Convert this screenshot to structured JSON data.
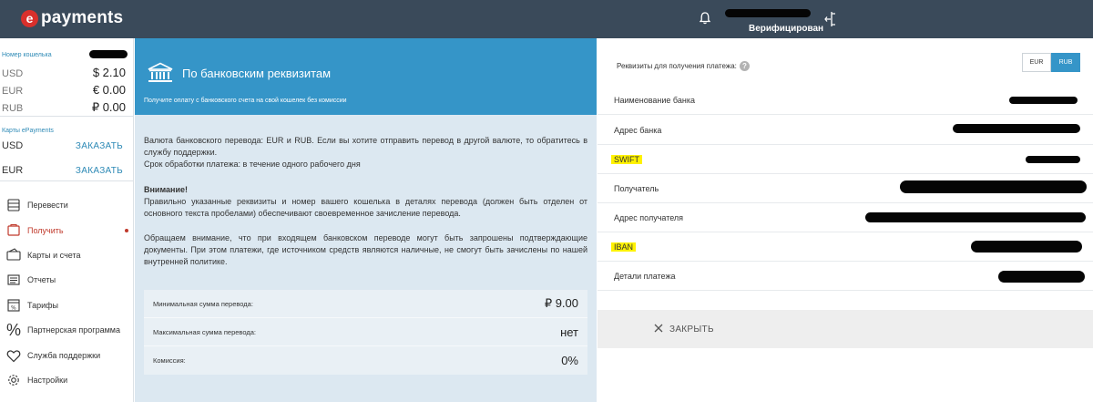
{
  "app": {
    "logo_letter": "e",
    "logo_text": "payments",
    "user_status": "Верифицирован"
  },
  "wallet": {
    "title": "Номер кошелька",
    "balances": [
      {
        "currency": "USD",
        "amount": "$ 2.10"
      },
      {
        "currency": "EUR",
        "amount": "€ 0.00"
      },
      {
        "currency": "RUB",
        "amount": "₽ 0.00"
      }
    ]
  },
  "cards": {
    "title": "Карты ePayments",
    "items": [
      {
        "currency": "USD",
        "action": "ЗАКАЗАТЬ"
      },
      {
        "currency": "EUR",
        "action": "ЗАКАЗАТЬ"
      }
    ]
  },
  "nav": [
    {
      "label": "Перевести",
      "icon": "transfer-icon"
    },
    {
      "label": "Получить",
      "icon": "receive-icon"
    },
    {
      "label": "Карты и счета",
      "icon": "card-icon"
    },
    {
      "label": "Отчеты",
      "icon": "reports-icon"
    },
    {
      "label": "Тарифы",
      "icon": "tariffs-icon"
    },
    {
      "label": "Партнерская программа",
      "icon": "percent-icon"
    },
    {
      "label": "Служба поддержки",
      "icon": "heart-icon"
    },
    {
      "label": "Настройки",
      "icon": "gear-icon"
    }
  ],
  "center": {
    "title": "По банковским реквизитам",
    "subtitle": "Получите оплату с банковского счета на свой кошелек без комиссии",
    "p1": "Валюта банковского перевода: EUR и RUB. Если вы хотите отправить перевод в другой валюте, то обратитесь в службу поддержки.",
    "p1b": "Срок обработки платежа: в течение одного рабочего дня",
    "attention": "Внимание!",
    "p2": "Правильно указанные реквизиты и номер вашего кошелька в деталях перевода (должен быть отделен от основного текста пробелами) обеспечивают своевременное зачисление перевода.",
    "p3": "Обращаем внимание, что при входящем банковском переводе могут быть запрошены подтверждающие документы. При этом платежи, где источником средств являются наличные, не смогут быть зачислены по нашей внутренней политике.",
    "fees": [
      {
        "label": "Минимальная сумма перевода:",
        "value": "₽ 9.00"
      },
      {
        "label": "Максимальная сумма перевода:",
        "value": "нет"
      },
      {
        "label": "Комиссия:",
        "value": "0%"
      }
    ]
  },
  "requisites": {
    "title": "Реквизиты для получения платежа:",
    "help": "?",
    "currencies": [
      "EUR",
      "RUB"
    ],
    "selected": "RUB",
    "rows": [
      {
        "label": "Наименование банка"
      },
      {
        "label": "Адрес банка"
      },
      {
        "label": "SWIFT"
      },
      {
        "label": "Получатель"
      },
      {
        "label": "Адрес получателя"
      },
      {
        "label": "IBAN"
      },
      {
        "label": "Детали платежа"
      }
    ],
    "close_label": "ЗАКРЫТЬ"
  }
}
